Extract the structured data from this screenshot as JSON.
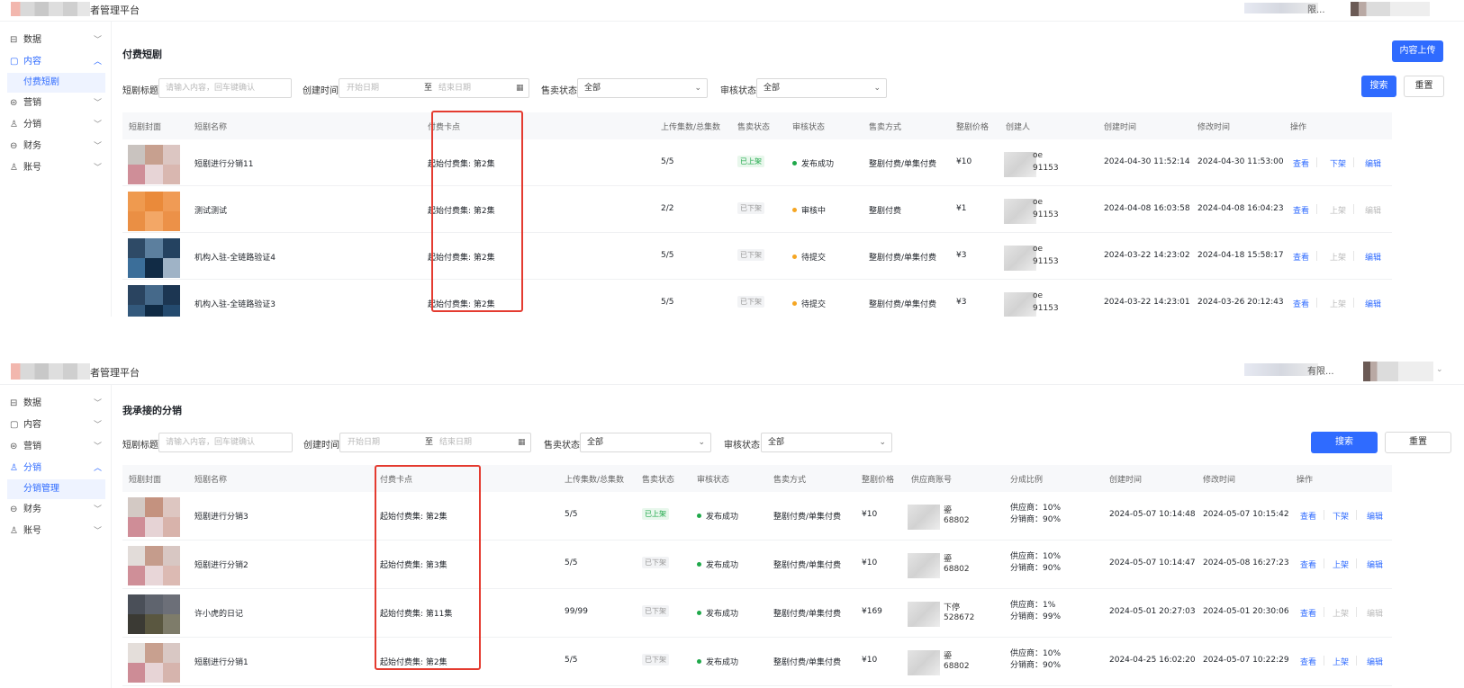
{
  "top": {
    "app_title": "者管理平台",
    "org_text": "限...",
    "sidebar": [
      {
        "icon": "chart-icon",
        "glyph": "⊟",
        "label": "数据",
        "open": false
      },
      {
        "icon": "content-icon",
        "glyph": "▢",
        "label": "内容",
        "open": true,
        "sub": "付费短剧"
      },
      {
        "icon": "marketing-icon",
        "glyph": "⊜",
        "label": "营销",
        "open": false
      },
      {
        "icon": "distribution-icon",
        "glyph": "♙",
        "label": "分销",
        "open": false
      },
      {
        "icon": "finance-icon",
        "glyph": "⊖",
        "label": "财务",
        "open": false
      },
      {
        "icon": "account-icon",
        "glyph": "♙",
        "label": "账号",
        "open": false
      }
    ],
    "page_title": "付费短剧",
    "upload_btn": "内容上传",
    "filters": {
      "title_label": "短剧标题",
      "title_placeholder": "请输入内容，回车键确认",
      "time_label": "创建时间",
      "start_placeholder": "开始日期",
      "to": "至",
      "end_placeholder": "结束日期",
      "sale_label": "售卖状态",
      "sale_value": "全部",
      "review_label": "审核状态",
      "review_value": "全部",
      "search": "搜索",
      "reset": "重置"
    },
    "columns": [
      "短剧封面",
      "短剧名称",
      "付费卡点",
      "上传集数/总集数",
      "售卖状态",
      "审核状态",
      "售卖方式",
      "整剧价格",
      "创建人",
      "创建时间",
      "修改时间",
      "操作"
    ],
    "rows": [
      {
        "name": "短剧进行分销11",
        "paypoint": "起始付费集: 第2集",
        "episodes": "5/5",
        "sale": "已上架",
        "sale_on": true,
        "review": "发布成功",
        "review_color": "#1fa84a",
        "method": "整剧付费/单集付费",
        "price": "¥10",
        "creator_a": "oe",
        "creator_b": "91153",
        "created": "2024-04-30 11:52:14",
        "modified": "2024-04-30 11:53:00",
        "actions": [
          "查看",
          "下架",
          "编辑"
        ],
        "disabled": [
          false,
          false,
          false
        ],
        "thumb": [
          "#c9c3bf",
          "#c7a08f",
          "#dcc6c2",
          "#cf8e98",
          "#e7d4d6",
          "#d9b7b0"
        ]
      },
      {
        "name": "测试测试",
        "paypoint": "起始付费集: 第2集",
        "episodes": "2/2",
        "sale": "已下架",
        "sale_on": false,
        "review": "审核中",
        "review_color": "#f5a623",
        "method": "整剧付费",
        "price": "¥1",
        "creator_a": "oe",
        "creator_b": "91153",
        "created": "2024-04-08 16:03:58",
        "modified": "2024-04-08 16:04:23",
        "actions": [
          "查看",
          "上架",
          "编辑"
        ],
        "disabled": [
          false,
          true,
          true
        ],
        "thumb": [
          "#ef9a4f",
          "#ea8a3a",
          "#f09b55",
          "#ea8f44",
          "#f3a766",
          "#ec9148"
        ]
      },
      {
        "name": "机构入驻-全链路验证4",
        "paypoint": "起始付费集: 第2集",
        "episodes": "5/5",
        "sale": "已下架",
        "sale_on": false,
        "review": "待提交",
        "review_color": "#f5a623",
        "method": "整剧付费/单集付费",
        "price": "¥3",
        "creator_a": "oe",
        "creator_b": "91153",
        "created": "2024-03-22 14:23:02",
        "modified": "2024-04-18 15:58:17",
        "actions": [
          "查看",
          "上架",
          "编辑"
        ],
        "disabled": [
          false,
          true,
          false
        ],
        "thumb": [
          "#2e4a66",
          "#5c7f9e",
          "#244260",
          "#3b6e99",
          "#112b45",
          "#9fb3c6"
        ]
      },
      {
        "name": "机构入驻-全链路验证3",
        "paypoint": "起始付费集: 第2集",
        "episodes": "5/5",
        "sale": "已下架",
        "sale_on": false,
        "review": "待提交",
        "review_color": "#f5a623",
        "method": "整剧付费/单集付费",
        "price": "¥3",
        "creator_a": "oe",
        "creator_b": "91153",
        "created": "2024-03-22 14:23:01",
        "modified": "2024-03-26 20:12:43",
        "actions": [
          "查看",
          "上架",
          "编辑"
        ],
        "disabled": [
          false,
          true,
          false
        ],
        "thumb": [
          "#2a4460",
          "#45698a",
          "#1c3652",
          "#33597c",
          "#0f2a44",
          "#244a6e"
        ]
      }
    ]
  },
  "bottom": {
    "app_title": "者管理平台",
    "org_text": "有限...",
    "sidebar": [
      {
        "icon": "chart-icon",
        "glyph": "⊟",
        "label": "数据",
        "open": false
      },
      {
        "icon": "content-icon",
        "glyph": "▢",
        "label": "内容",
        "open": false
      },
      {
        "icon": "marketing-icon",
        "glyph": "⊜",
        "label": "营销",
        "open": false
      },
      {
        "icon": "distribution-icon",
        "glyph": "♙",
        "label": "分销",
        "open": true,
        "sub": "分销管理"
      },
      {
        "icon": "finance-icon",
        "glyph": "⊖",
        "label": "财务",
        "open": false
      },
      {
        "icon": "account-icon",
        "glyph": "♙",
        "label": "账号",
        "open": false
      }
    ],
    "page_title": "我承接的分销",
    "filters": {
      "title_label": "短剧标题",
      "title_placeholder": "请输入内容，回车键确认",
      "time_label": "创建时间",
      "start_placeholder": "开始日期",
      "to": "至",
      "end_placeholder": "结束日期",
      "sale_label": "售卖状态",
      "sale_value": "全部",
      "review_label": "审核状态",
      "review_value": "全部",
      "search": "搜索",
      "reset": "重置"
    },
    "columns": [
      "短剧封面",
      "短剧名称",
      "付费卡点",
      "上传集数/总集数",
      "售卖状态",
      "审核状态",
      "售卖方式",
      "整剧价格",
      "供应商账号",
      "分成比例",
      "创建时间",
      "修改时间",
      "操作"
    ],
    "rows": [
      {
        "name": "短剧进行分销3",
        "paypoint": "起始付费集: 第2集",
        "episodes": "5/5",
        "sale": "已上架",
        "sale_on": true,
        "review": "发布成功",
        "review_color": "#1fa84a",
        "method": "整剧付费/单集付费",
        "price": "¥10",
        "supplier_a": "鎏",
        "supplier_b": "68802",
        "ratio_supplier": "供应商：10%",
        "ratio_distributor": "分销商：90%",
        "created": "2024-05-07 10:14:48",
        "modified": "2024-05-07 10:15:42",
        "actions": [
          "查看",
          "下架",
          "编辑"
        ],
        "disabled": [
          false,
          false,
          false
        ],
        "thumb": [
          "#d3c9c4",
          "#c4927f",
          "#ddc6c1",
          "#cf8d97",
          "#e6d3d5",
          "#d8b3ab"
        ]
      },
      {
        "name": "短剧进行分销2",
        "paypoint": "起始付费集: 第3集",
        "episodes": "5/5",
        "sale": "已下架",
        "sale_on": false,
        "review": "发布成功",
        "review_color": "#1fa84a",
        "method": "整剧付费/单集付费",
        "price": "¥10",
        "supplier_a": "鎏",
        "supplier_b": "68802",
        "ratio_supplier": "供应商：10%",
        "ratio_distributor": "分销商：90%",
        "created": "2024-05-07 10:14:47",
        "modified": "2024-05-08 16:27:23",
        "actions": [
          "查看",
          "上架",
          "编辑"
        ],
        "disabled": [
          false,
          false,
          false
        ],
        "thumb": [
          "#e2dcd9",
          "#c59c8c",
          "#d8c7c3",
          "#cf8f98",
          "#e8d6d8",
          "#dcbab3"
        ]
      },
      {
        "name": "许小虎的日记",
        "paypoint": "起始付费集: 第11集",
        "episodes": "99/99",
        "sale": "已下架",
        "sale_on": false,
        "review": "发布成功",
        "review_color": "#1fa84a",
        "method": "整剧付费/单集付费",
        "price": "¥169",
        "supplier_a": "下停",
        "supplier_b": "528672",
        "ratio_supplier": "供应商：1%",
        "ratio_distributor": "分销商：99%",
        "created": "2024-05-01 20:27:03",
        "modified": "2024-05-01 20:30:06",
        "actions": [
          "查看",
          "上架",
          "编辑"
        ],
        "disabled": [
          false,
          true,
          true
        ],
        "thumb": [
          "#4a4f58",
          "#5f646e",
          "#6c6f78",
          "#3b3a34",
          "#5a5740",
          "#7e7c6a"
        ]
      },
      {
        "name": "短剧进行分销1",
        "paypoint": "起始付费集: 第2集",
        "episodes": "5/5",
        "sale": "已下架",
        "sale_on": false,
        "review": "发布成功",
        "review_color": "#1fa84a",
        "method": "整剧付费/单集付费",
        "price": "¥10",
        "supplier_a": "鎏",
        "supplier_b": "68802",
        "ratio_supplier": "供应商：10%",
        "ratio_distributor": "分销商：90%",
        "created": "2024-04-25 16:02:20",
        "modified": "2024-05-07 10:22:29",
        "actions": [
          "查看",
          "上架",
          "编辑"
        ],
        "disabled": [
          false,
          false,
          false
        ],
        "thumb": [
          "#e4deda",
          "#c8a08f",
          "#d9c8c4",
          "#cd8c96",
          "#e7d4d6",
          "#d6b4ad"
        ]
      }
    ]
  }
}
